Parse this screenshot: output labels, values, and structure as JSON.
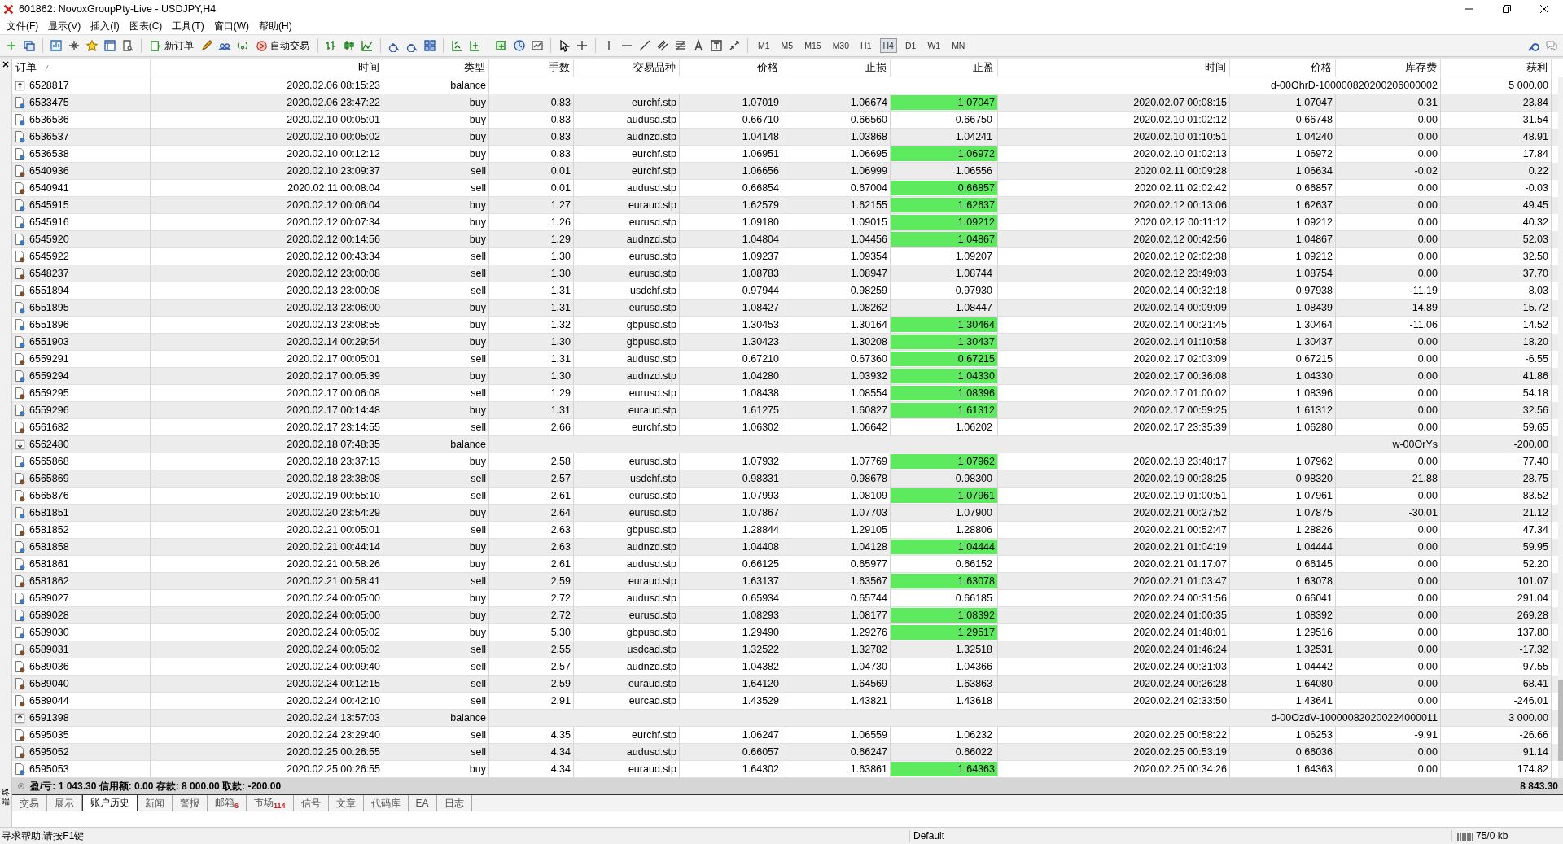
{
  "window": {
    "title": "601862: NovoxGroupPty-Live - USDJPY,H4"
  },
  "menu": [
    "文件(F)",
    "显示(V)",
    "插入(I)",
    "图表(C)",
    "工具(T)",
    "窗口(W)",
    "帮助(H)"
  ],
  "toolbar": {
    "buttons": [
      "新订单",
      "自动交易"
    ],
    "timeframes": [
      {
        "label": "M1",
        "selected": false
      },
      {
        "label": "M5",
        "selected": false
      },
      {
        "label": "M15",
        "selected": false
      },
      {
        "label": "M30",
        "selected": false
      },
      {
        "label": "H1",
        "selected": false
      },
      {
        "label": "H4",
        "selected": true
      },
      {
        "label": "D1",
        "selected": false
      },
      {
        "label": "W1",
        "selected": false
      },
      {
        "label": "MN",
        "selected": false
      }
    ]
  },
  "columns": [
    "订单",
    "时间",
    "类型",
    "手数",
    "交易品种",
    "价格",
    "止损",
    "止盈",
    "时间",
    "价格",
    "库存费",
    "获利"
  ],
  "rows": [
    {
      "kind": "deposit",
      "order": "6528817",
      "time": "2020.02.06 08:15:23",
      "type": "balance",
      "comment": "d-00OhrD-100000820200206000002",
      "profit": "5 000.00"
    },
    {
      "kind": "buy",
      "order": "6533475",
      "time": "2020.02.06 23:47:22",
      "type": "buy",
      "lots": "0.83",
      "symbol": "eurchf.stp",
      "price": "1.07019",
      "sl": "1.06674",
      "tp": "1.07047",
      "tp_hit": true,
      "close_time": "2020.02.07 00:08:15",
      "close_price": "1.07047",
      "swap": "0.31",
      "profit": "23.84"
    },
    {
      "kind": "buy",
      "order": "6536536",
      "time": "2020.02.10 00:05:01",
      "type": "buy",
      "lots": "0.83",
      "symbol": "audusd.stp",
      "price": "0.66710",
      "sl": "0.66560",
      "tp": "0.66750",
      "tp_hit": false,
      "close_time": "2020.02.10 01:02:12",
      "close_price": "0.66748",
      "swap": "0.00",
      "profit": "31.54"
    },
    {
      "kind": "buy",
      "order": "6536537",
      "time": "2020.02.10 00:05:02",
      "type": "buy",
      "lots": "0.83",
      "symbol": "audnzd.stp",
      "price": "1.04148",
      "sl": "1.03868",
      "tp": "1.04241",
      "tp_hit": false,
      "close_time": "2020.02.10 01:10:51",
      "close_price": "1.04240",
      "swap": "0.00",
      "profit": "48.91"
    },
    {
      "kind": "buy",
      "order": "6536538",
      "time": "2020.02.10 00:12:12",
      "type": "buy",
      "lots": "0.83",
      "symbol": "eurchf.stp",
      "price": "1.06951",
      "sl": "1.06695",
      "tp": "1.06972",
      "tp_hit": true,
      "close_time": "2020.02.10 01:02:13",
      "close_price": "1.06972",
      "swap": "0.00",
      "profit": "17.84"
    },
    {
      "kind": "sell",
      "order": "6540936",
      "time": "2020.02.10 23:09:37",
      "type": "sell",
      "lots": "0.01",
      "symbol": "eurchf.stp",
      "price": "1.06656",
      "sl": "1.06999",
      "tp": "1.06556",
      "tp_hit": false,
      "close_time": "2020.02.11 00:09:28",
      "close_price": "1.06634",
      "swap": "-0.02",
      "profit": "0.22"
    },
    {
      "kind": "sell",
      "order": "6540941",
      "time": "2020.02.11 00:08:04",
      "type": "sell",
      "lots": "0.01",
      "symbol": "audusd.stp",
      "price": "0.66854",
      "sl": "0.67004",
      "tp": "0.66857",
      "tp_hit": true,
      "close_time": "2020.02.11 02:02:42",
      "close_price": "0.66857",
      "swap": "0.00",
      "profit": "-0.03"
    },
    {
      "kind": "buy",
      "order": "6545915",
      "time": "2020.02.12 00:06:04",
      "type": "buy",
      "lots": "1.27",
      "symbol": "euraud.stp",
      "price": "1.62579",
      "sl": "1.62155",
      "tp": "1.62637",
      "tp_hit": true,
      "close_time": "2020.02.12 00:13:06",
      "close_price": "1.62637",
      "swap": "0.00",
      "profit": "49.45"
    },
    {
      "kind": "buy",
      "order": "6545916",
      "time": "2020.02.12 00:07:34",
      "type": "buy",
      "lots": "1.26",
      "symbol": "eurusd.stp",
      "price": "1.09180",
      "sl": "1.09015",
      "tp": "1.09212",
      "tp_hit": true,
      "close_time": "2020.02.12 00:11:12",
      "close_price": "1.09212",
      "swap": "0.00",
      "profit": "40.32"
    },
    {
      "kind": "buy",
      "order": "6545920",
      "time": "2020.02.12 00:14:56",
      "type": "buy",
      "lots": "1.29",
      "symbol": "audnzd.stp",
      "price": "1.04804",
      "sl": "1.04456",
      "tp": "1.04867",
      "tp_hit": true,
      "close_time": "2020.02.12 00:42:56",
      "close_price": "1.04867",
      "swap": "0.00",
      "profit": "52.03"
    },
    {
      "kind": "sell",
      "order": "6545922",
      "time": "2020.02.12 00:43:34",
      "type": "sell",
      "lots": "1.30",
      "symbol": "eurusd.stp",
      "price": "1.09237",
      "sl": "1.09354",
      "tp": "1.09207",
      "tp_hit": false,
      "close_time": "2020.02.12 02:02:38",
      "close_price": "1.09212",
      "swap": "0.00",
      "profit": "32.50"
    },
    {
      "kind": "sell",
      "order": "6548237",
      "time": "2020.02.12 23:00:08",
      "type": "sell",
      "lots": "1.30",
      "symbol": "eurusd.stp",
      "price": "1.08783",
      "sl": "1.08947",
      "tp": "1.08744",
      "tp_hit": false,
      "close_time": "2020.02.12 23:49:03",
      "close_price": "1.08754",
      "swap": "0.00",
      "profit": "37.70"
    },
    {
      "kind": "sell",
      "order": "6551894",
      "time": "2020.02.13 23:00:08",
      "type": "sell",
      "lots": "1.31",
      "symbol": "usdchf.stp",
      "price": "0.97944",
      "sl": "0.98259",
      "tp": "0.97930",
      "tp_hit": false,
      "close_time": "2020.02.14 00:32:18",
      "close_price": "0.97938",
      "swap": "-11.19",
      "profit": "8.03"
    },
    {
      "kind": "buy",
      "order": "6551895",
      "time": "2020.02.13 23:06:00",
      "type": "buy",
      "lots": "1.31",
      "symbol": "eurusd.stp",
      "price": "1.08427",
      "sl": "1.08262",
      "tp": "1.08447",
      "tp_hit": false,
      "close_time": "2020.02.14 00:09:09",
      "close_price": "1.08439",
      "swap": "-14.89",
      "profit": "15.72"
    },
    {
      "kind": "buy",
      "order": "6551896",
      "time": "2020.02.13 23:08:55",
      "type": "buy",
      "lots": "1.32",
      "symbol": "gbpusd.stp",
      "price": "1.30453",
      "sl": "1.30164",
      "tp": "1.30464",
      "tp_hit": true,
      "close_time": "2020.02.14 00:21:45",
      "close_price": "1.30464",
      "swap": "-11.06",
      "profit": "14.52"
    },
    {
      "kind": "buy",
      "order": "6551903",
      "time": "2020.02.14 00:29:54",
      "type": "buy",
      "lots": "1.30",
      "symbol": "gbpusd.stp",
      "price": "1.30423",
      "sl": "1.30208",
      "tp": "1.30437",
      "tp_hit": true,
      "close_time": "2020.02.14 01:10:58",
      "close_price": "1.30437",
      "swap": "0.00",
      "profit": "18.20"
    },
    {
      "kind": "sell",
      "order": "6559291",
      "time": "2020.02.17 00:05:01",
      "type": "sell",
      "lots": "1.31",
      "symbol": "audusd.stp",
      "price": "0.67210",
      "sl": "0.67360",
      "tp": "0.67215",
      "tp_hit": true,
      "close_time": "2020.02.17 02:03:09",
      "close_price": "0.67215",
      "swap": "0.00",
      "profit": "-6.55"
    },
    {
      "kind": "buy",
      "order": "6559294",
      "time": "2020.02.17 00:05:39",
      "type": "buy",
      "lots": "1.30",
      "symbol": "audnzd.stp",
      "price": "1.04280",
      "sl": "1.03932",
      "tp": "1.04330",
      "tp_hit": true,
      "close_time": "2020.02.17 00:36:08",
      "close_price": "1.04330",
      "swap": "0.00",
      "profit": "41.86"
    },
    {
      "kind": "sell",
      "order": "6559295",
      "time": "2020.02.17 00:06:08",
      "type": "sell",
      "lots": "1.29",
      "symbol": "eurusd.stp",
      "price": "1.08438",
      "sl": "1.08554",
      "tp": "1.08396",
      "tp_hit": true,
      "close_time": "2020.02.17 01:00:02",
      "close_price": "1.08396",
      "swap": "0.00",
      "profit": "54.18"
    },
    {
      "kind": "buy",
      "order": "6559296",
      "time": "2020.02.17 00:14:48",
      "type": "buy",
      "lots": "1.31",
      "symbol": "euraud.stp",
      "price": "1.61275",
      "sl": "1.60827",
      "tp": "1.61312",
      "tp_hit": true,
      "close_time": "2020.02.17 00:59:25",
      "close_price": "1.61312",
      "swap": "0.00",
      "profit": "32.56"
    },
    {
      "kind": "sell",
      "order": "6561682",
      "time": "2020.02.17 23:14:55",
      "type": "sell",
      "lots": "2.66",
      "symbol": "eurchf.stp",
      "price": "1.06302",
      "sl": "1.06642",
      "tp": "1.06202",
      "tp_hit": false,
      "close_time": "2020.02.17 23:35:39",
      "close_price": "1.06280",
      "swap": "0.00",
      "profit": "59.65"
    },
    {
      "kind": "withdrawal",
      "order": "6562480",
      "time": "2020.02.18 07:48:35",
      "type": "balance",
      "comment": "w-00OrYs",
      "profit": "-200.00"
    },
    {
      "kind": "buy",
      "order": "6565868",
      "time": "2020.02.18 23:37:13",
      "type": "buy",
      "lots": "2.58",
      "symbol": "eurusd.stp",
      "price": "1.07932",
      "sl": "1.07769",
      "tp": "1.07962",
      "tp_hit": true,
      "close_time": "2020.02.18 23:48:17",
      "close_price": "1.07962",
      "swap": "0.00",
      "profit": "77.40"
    },
    {
      "kind": "sell",
      "order": "6565869",
      "time": "2020.02.18 23:38:08",
      "type": "sell",
      "lots": "2.57",
      "symbol": "usdchf.stp",
      "price": "0.98331",
      "sl": "0.98678",
      "tp": "0.98300",
      "tp_hit": false,
      "close_time": "2020.02.19 00:28:25",
      "close_price": "0.98320",
      "swap": "-21.88",
      "profit": "28.75"
    },
    {
      "kind": "sell",
      "order": "6565876",
      "time": "2020.02.19 00:55:10",
      "type": "sell",
      "lots": "2.61",
      "symbol": "eurusd.stp",
      "price": "1.07993",
      "sl": "1.08109",
      "tp": "1.07961",
      "tp_hit": true,
      "close_time": "2020.02.19 01:00:51",
      "close_price": "1.07961",
      "swap": "0.00",
      "profit": "83.52"
    },
    {
      "kind": "buy",
      "order": "6581851",
      "time": "2020.02.20 23:54:29",
      "type": "buy",
      "lots": "2.64",
      "symbol": "eurusd.stp",
      "price": "1.07867",
      "sl": "1.07703",
      "tp": "1.07900",
      "tp_hit": false,
      "close_time": "2020.02.21 00:27:52",
      "close_price": "1.07875",
      "swap": "-30.01",
      "profit": "21.12"
    },
    {
      "kind": "sell",
      "order": "6581852",
      "time": "2020.02.21 00:05:01",
      "type": "sell",
      "lots": "2.63",
      "symbol": "gbpusd.stp",
      "price": "1.28844",
      "sl": "1.29105",
      "tp": "1.28806",
      "tp_hit": false,
      "close_time": "2020.02.21 00:52:47",
      "close_price": "1.28826",
      "swap": "0.00",
      "profit": "47.34"
    },
    {
      "kind": "buy",
      "order": "6581858",
      "time": "2020.02.21 00:44:14",
      "type": "buy",
      "lots": "2.63",
      "symbol": "audnzd.stp",
      "price": "1.04408",
      "sl": "1.04128",
      "tp": "1.04444",
      "tp_hit": true,
      "close_time": "2020.02.21 01:04:19",
      "close_price": "1.04444",
      "swap": "0.00",
      "profit": "59.95"
    },
    {
      "kind": "buy",
      "order": "6581861",
      "time": "2020.02.21 00:58:26",
      "type": "buy",
      "lots": "2.61",
      "symbol": "audusd.stp",
      "price": "0.66125",
      "sl": "0.65977",
      "tp": "0.66152",
      "tp_hit": false,
      "close_time": "2020.02.21 01:17:07",
      "close_price": "0.66145",
      "swap": "0.00",
      "profit": "52.20"
    },
    {
      "kind": "sell",
      "order": "6581862",
      "time": "2020.02.21 00:58:41",
      "type": "sell",
      "lots": "2.59",
      "symbol": "euraud.stp",
      "price": "1.63137",
      "sl": "1.63567",
      "tp": "1.63078",
      "tp_hit": true,
      "close_time": "2020.02.21 01:03:47",
      "close_price": "1.63078",
      "swap": "0.00",
      "profit": "101.07"
    },
    {
      "kind": "buy",
      "order": "6589027",
      "time": "2020.02.24 00:05:00",
      "type": "buy",
      "lots": "2.72",
      "symbol": "audusd.stp",
      "price": "0.65934",
      "sl": "0.65744",
      "tp": "0.66185",
      "tp_hit": false,
      "close_time": "2020.02.24 00:31:56",
      "close_price": "0.66041",
      "swap": "0.00",
      "profit": "291.04"
    },
    {
      "kind": "buy",
      "order": "6589028",
      "time": "2020.02.24 00:05:00",
      "type": "buy",
      "lots": "2.72",
      "symbol": "eurusd.stp",
      "price": "1.08293",
      "sl": "1.08177",
      "tp": "1.08392",
      "tp_hit": true,
      "close_time": "2020.02.24 01:00:35",
      "close_price": "1.08392",
      "swap": "0.00",
      "profit": "269.28"
    },
    {
      "kind": "buy",
      "order": "6589030",
      "time": "2020.02.24 00:05:02",
      "type": "buy",
      "lots": "5.30",
      "symbol": "gbpusd.stp",
      "price": "1.29490",
      "sl": "1.29276",
      "tp": "1.29517",
      "tp_hit": true,
      "close_time": "2020.02.24 01:48:01",
      "close_price": "1.29516",
      "swap": "0.00",
      "profit": "137.80"
    },
    {
      "kind": "sell",
      "order": "6589031",
      "time": "2020.02.24 00:05:02",
      "type": "sell",
      "lots": "2.55",
      "symbol": "usdcad.stp",
      "price": "1.32522",
      "sl": "1.32782",
      "tp": "1.32518",
      "tp_hit": false,
      "close_time": "2020.02.24 01:46:24",
      "close_price": "1.32531",
      "swap": "0.00",
      "profit": "-17.32"
    },
    {
      "kind": "sell",
      "order": "6589036",
      "time": "2020.02.24 00:09:40",
      "type": "sell",
      "lots": "2.57",
      "symbol": "audnzd.stp",
      "price": "1.04382",
      "sl": "1.04730",
      "tp": "1.04366",
      "tp_hit": false,
      "close_time": "2020.02.24 00:31:03",
      "close_price": "1.04442",
      "swap": "0.00",
      "profit": "-97.55"
    },
    {
      "kind": "sell",
      "order": "6589040",
      "time": "2020.02.24 00:12:15",
      "type": "sell",
      "lots": "2.59",
      "symbol": "euraud.stp",
      "price": "1.64120",
      "sl": "1.64569",
      "tp": "1.63863",
      "tp_hit": false,
      "close_time": "2020.02.24 00:26:28",
      "close_price": "1.64080",
      "swap": "0.00",
      "profit": "68.41"
    },
    {
      "kind": "sell",
      "order": "6589044",
      "time": "2020.02.24 00:42:10",
      "type": "sell",
      "lots": "2.91",
      "symbol": "eurcad.stp",
      "price": "1.43529",
      "sl": "1.43821",
      "tp": "1.43618",
      "tp_hit": false,
      "close_time": "2020.02.24 02:33:50",
      "close_price": "1.43641",
      "swap": "0.00",
      "profit": "-246.01"
    },
    {
      "kind": "deposit",
      "order": "6591398",
      "time": "2020.02.24 13:57:03",
      "type": "balance",
      "comment": "d-00OzdV-100000820200224000011",
      "profit": "3 000.00"
    },
    {
      "kind": "sell",
      "order": "6595035",
      "time": "2020.02.24 23:29:40",
      "type": "sell",
      "lots": "4.35",
      "symbol": "eurchf.stp",
      "price": "1.06247",
      "sl": "1.06559",
      "tp": "1.06232",
      "tp_hit": false,
      "close_time": "2020.02.25 00:58:22",
      "close_price": "1.06253",
      "swap": "-9.91",
      "profit": "-26.66"
    },
    {
      "kind": "sell",
      "order": "6595052",
      "time": "2020.02.25 00:26:55",
      "type": "sell",
      "lots": "4.34",
      "symbol": "audusd.stp",
      "price": "0.66057",
      "sl": "0.66247",
      "tp": "0.66022",
      "tp_hit": false,
      "close_time": "2020.02.25 00:53:19",
      "close_price": "0.66036",
      "swap": "0.00",
      "profit": "91.14"
    },
    {
      "kind": "buy",
      "order": "6595053",
      "time": "2020.02.25 00:26:55",
      "type": "buy",
      "lots": "4.34",
      "symbol": "euraud.stp",
      "price": "1.64302",
      "sl": "1.63861",
      "tp": "1.64363",
      "tp_hit": true,
      "close_time": "2020.02.25 00:34:26",
      "close_price": "1.64363",
      "swap": "0.00",
      "profit": "174.82"
    }
  ],
  "summary": {
    "text": "盈/亏: 1 043.30  信用额: 0.00  存款: 8 000.00  取款: -200.00",
    "total": "8 843.30"
  },
  "terminal_label": "终端",
  "tabs": [
    {
      "label": "交易",
      "selected": false
    },
    {
      "label": "展示",
      "selected": false
    },
    {
      "label": "账户历史",
      "selected": true
    },
    {
      "label": "新闻",
      "selected": false
    },
    {
      "label": "警报",
      "selected": false
    },
    {
      "label": "邮箱",
      "badge": "6",
      "selected": false
    },
    {
      "label": "市场",
      "badge": "114",
      "selected": false
    },
    {
      "label": "信号",
      "selected": false
    },
    {
      "label": "文章",
      "selected": false
    },
    {
      "label": "代码库",
      "selected": false
    },
    {
      "label": "EA",
      "selected": false
    },
    {
      "label": "日志",
      "selected": false
    }
  ],
  "status_bar": {
    "help": "寻求帮助,请按F1键",
    "profile": "Default",
    "traffic": "75/0 kb"
  }
}
